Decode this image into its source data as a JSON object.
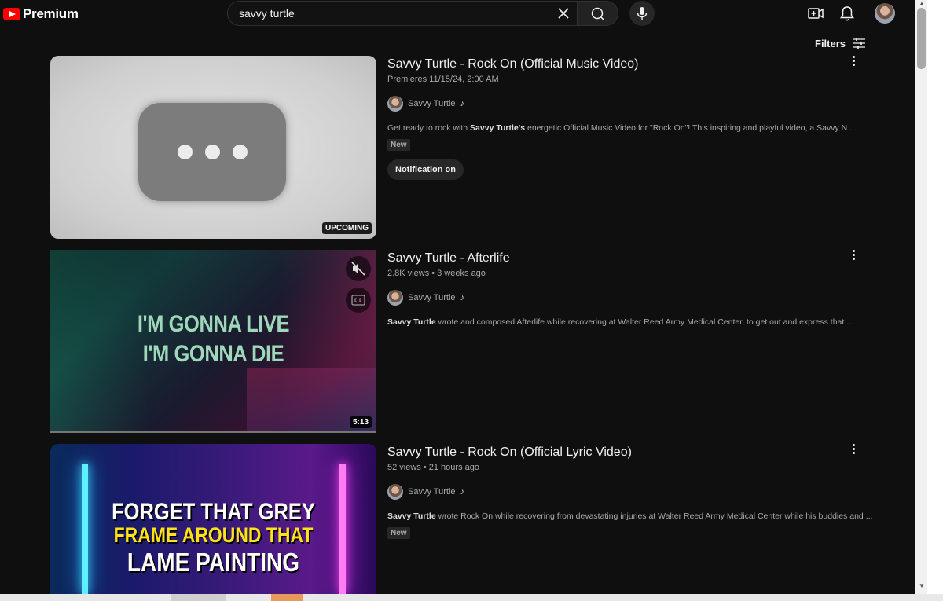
{
  "header": {
    "logo_text": "Premium",
    "search_value": "savvy turtle"
  },
  "filters_label": "Filters",
  "results": [
    {
      "title": "Savvy Turtle - Rock On (Official Music Video)",
      "meta": "Premieres 11/15/24, 2:00 AM",
      "channel": "Savvy Turtle",
      "description_bold": "Savvy Turtle's",
      "description_pre": "Get ready to rock with ",
      "description_post": " energetic Official Music Video for \"Rock On\"! This inspiring and playful video, a Savvy N ...",
      "badge": "New",
      "button": "Notification on",
      "overlay": "UPCOMING"
    },
    {
      "title": "Savvy Turtle - Afterlife",
      "meta": "2.8K views • 3 weeks ago",
      "channel": "Savvy Turtle",
      "description_bold": "Savvy Turtle",
      "description_post": " wrote and composed Afterlife while recovering at Walter Reed Army Medical Center, to get out and express that ...",
      "overlay": "5:13",
      "thumb_text": [
        "I'M GONNA LIVE",
        "I'M GONNA DIE"
      ]
    },
    {
      "title": "Savvy Turtle - Rock On (Official Lyric Video)",
      "meta": "52 views • 21 hours ago",
      "channel": "Savvy Turtle",
      "description_bold": "Savvy Turtle",
      "description_post": " wrote Rock On while recovering from devastating injuries at Walter Reed Army Medical Center while his buddies and ...",
      "badge": "New",
      "thumb_text": [
        "FORGET THAT GREY",
        "FRAME AROUND THAT",
        "LAME PAINTING"
      ]
    }
  ],
  "colors": {
    "accent": "#ff0000",
    "background": "#0f0f0f"
  }
}
